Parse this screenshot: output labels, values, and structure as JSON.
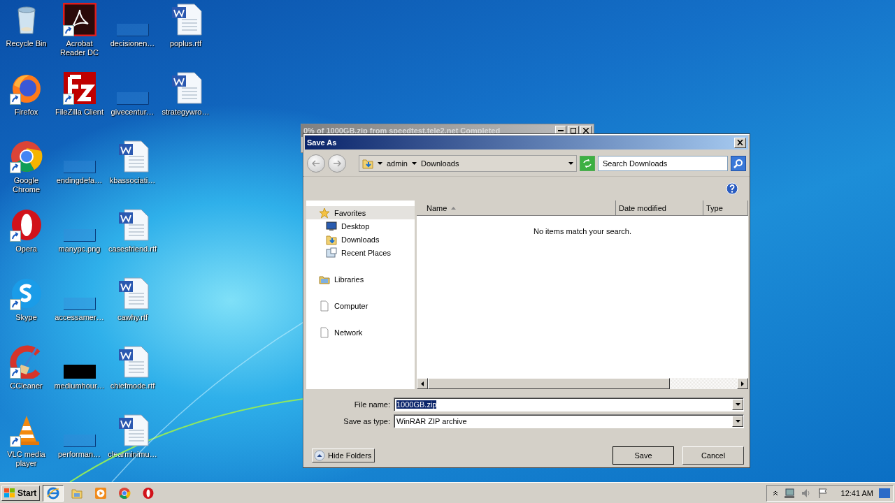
{
  "desktop": {
    "columns": [
      [
        {
          "label": "Recycle Bin",
          "kind": "recycle",
          "shortcut": false
        },
        {
          "label": "Firefox",
          "kind": "firefox",
          "shortcut": true
        },
        {
          "label": "Google Chrome",
          "kind": "chrome",
          "shortcut": true
        },
        {
          "label": "Opera",
          "kind": "opera",
          "shortcut": true
        },
        {
          "label": "Skype",
          "kind": "skype",
          "shortcut": true
        },
        {
          "label": "CCleaner",
          "kind": "ccleaner",
          "shortcut": true
        },
        {
          "label": "VLC media player",
          "kind": "vlc",
          "shortcut": true
        }
      ],
      [
        {
          "label": "Acrobat Reader DC",
          "kind": "acrobat",
          "shortcut": true
        },
        {
          "label": "FileZilla Client",
          "kind": "filezilla",
          "shortcut": true
        },
        {
          "label": "endingdefa…",
          "kind": "blank",
          "shortcut": false
        },
        {
          "label": "manypc.png",
          "kind": "blank",
          "shortcut": false
        },
        {
          "label": "accessamer…",
          "kind": "blank",
          "shortcut": false
        },
        {
          "label": "mediumhour…",
          "kind": "black",
          "shortcut": false
        },
        {
          "label": "performan…",
          "kind": "blank",
          "shortcut": false
        }
      ],
      [
        {
          "label": "decisionen…",
          "kind": "blank",
          "shortcut": false
        },
        {
          "label": "givecentur…",
          "kind": "blank",
          "shortcut": false
        },
        {
          "label": "kbassociati…",
          "kind": "word",
          "shortcut": false
        },
        {
          "label": "casesfriend.rtf",
          "kind": "word",
          "shortcut": false
        },
        {
          "label": "cawhy.rtf",
          "kind": "word",
          "shortcut": false
        },
        {
          "label": "chiefmode.rtf",
          "kind": "word",
          "shortcut": false
        },
        {
          "label": "clearminimu…",
          "kind": "word",
          "shortcut": false
        }
      ],
      [
        {
          "label": "poplus.rtf",
          "kind": "word",
          "shortcut": false
        },
        {
          "label": "strategywro…",
          "kind": "word",
          "shortcut": false
        }
      ]
    ]
  },
  "background_window": {
    "title": "0% of 1000GB.zip from speedtest.tele2.net Completed"
  },
  "dialog": {
    "title": "Save As",
    "breadcrumb": [
      "admin",
      "Downloads"
    ],
    "search": {
      "placeholder": "Search Downloads"
    },
    "nav": [
      {
        "label": "Favorites",
        "kind": "star",
        "selected": true,
        "children": [
          {
            "label": "Desktop",
            "kind": "desktop",
            "selected": false
          },
          {
            "label": "Downloads",
            "kind": "downloads",
            "selected": false
          },
          {
            "label": "Recent Places",
            "kind": "recent",
            "selected": false
          }
        ]
      },
      {
        "label": "Libraries",
        "kind": "libraries",
        "selected": false
      },
      {
        "label": "Computer",
        "kind": "computer",
        "selected": false
      },
      {
        "label": "Network",
        "kind": "network",
        "selected": false
      }
    ],
    "columns": [
      {
        "label": "Name",
        "sorted": true
      },
      {
        "label": "Date modified",
        "sorted": false
      },
      {
        "label": "Type",
        "sorted": false
      }
    ],
    "empty_message": "No items match your search.",
    "file_name": {
      "label": "File name:",
      "value": "1000GB.zip"
    },
    "save_as_type": {
      "label": "Save as type:",
      "value": "WinRAR ZIP archive"
    },
    "hide_folders": "Hide Folders",
    "buttons": [
      {
        "label": "Save",
        "kind": "default"
      },
      {
        "label": "Cancel",
        "kind": "normal"
      }
    ]
  },
  "taskbar": {
    "start": "Start",
    "items": [
      {
        "kind": "ie",
        "selected": true
      },
      {
        "kind": "explorer",
        "selected": false
      },
      {
        "kind": "media",
        "selected": false
      },
      {
        "kind": "chrome",
        "selected": false
      },
      {
        "kind": "opera",
        "selected": false
      }
    ],
    "clock": "12:41 AM"
  }
}
